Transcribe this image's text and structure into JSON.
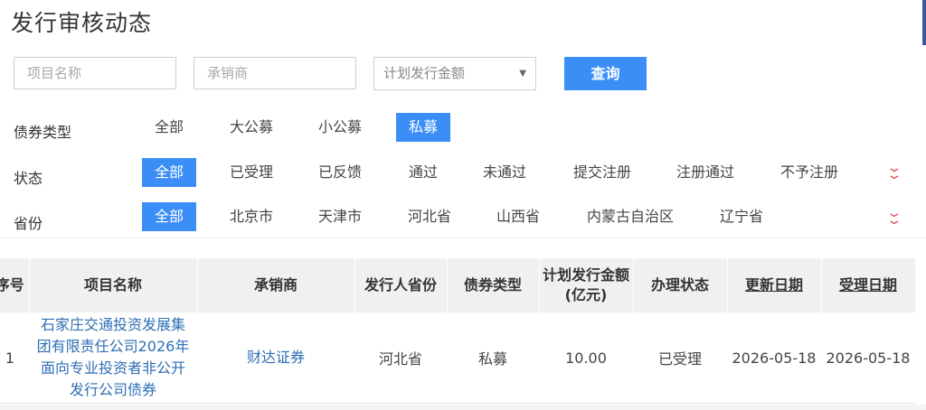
{
  "page": {
    "title": "发行审核动态"
  },
  "search": {
    "project_placeholder": "项目名称",
    "underwriter_placeholder": "承销商",
    "amount_select": "计划发行金额",
    "button": "查询"
  },
  "filters": {
    "bond_type": {
      "label": "债券类型",
      "options": [
        "全部",
        "大公募",
        "小公募",
        "私募"
      ],
      "selected": "私募"
    },
    "status": {
      "label": "状态",
      "options": [
        "全部",
        "已受理",
        "已反馈",
        "通过",
        "未通过",
        "提交注册",
        "注册通过",
        "不予注册"
      ],
      "selected": "全部"
    },
    "province": {
      "label": "省份",
      "options": [
        "全部",
        "北京市",
        "天津市",
        "河北省",
        "山西省",
        "内蒙古自治区",
        "辽宁省"
      ],
      "selected": "全部"
    }
  },
  "table": {
    "headers": [
      "序号",
      "项目名称",
      "承销商",
      "发行人省份",
      "债券类型",
      "计划发行金额",
      "(亿元)",
      "办理状态",
      "更新日期",
      "受理日期"
    ],
    "rows": [
      {
        "no": "1",
        "name_lines": [
          "石家庄交通投资发展集",
          "团有限责任公司2026年",
          "面向专业投资者非公开",
          "发行公司债券"
        ],
        "underwriter": "财达证券",
        "province": "河北省",
        "bond_type": "私募",
        "amount": "10.00",
        "status": "已受理",
        "updated": "2026-05-18",
        "accepted": "2026-05-18"
      }
    ]
  },
  "colors": {
    "accent": "#3a8ef6",
    "link": "#2e6fb5",
    "expand": "#e0505a"
  }
}
